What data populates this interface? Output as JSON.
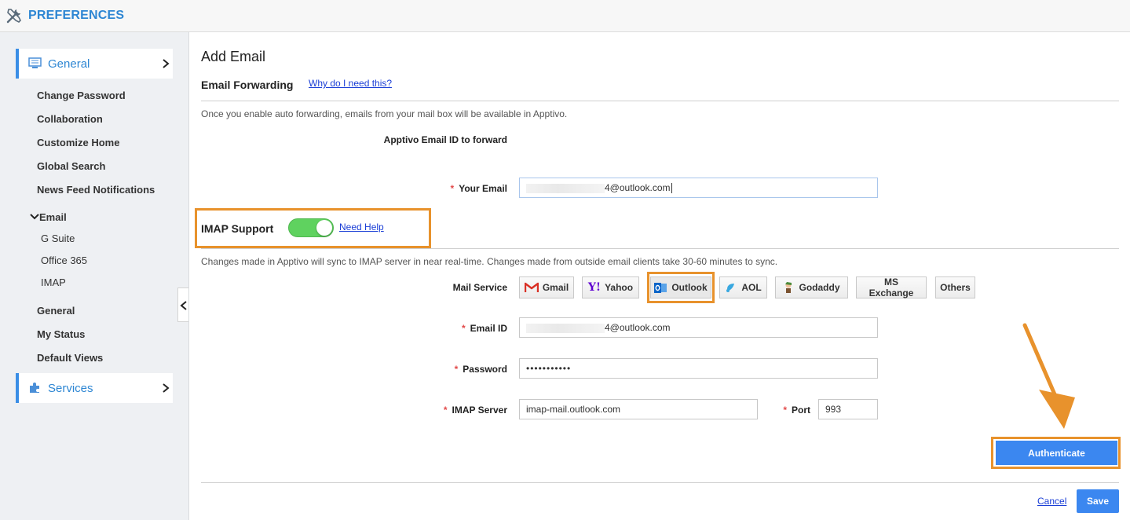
{
  "header": {
    "title": "PREFERENCES",
    "icon": "tools-icon",
    "color": "#2d86d3"
  },
  "sidebar": {
    "general": {
      "label": "General",
      "icon": "monitor-icon"
    },
    "items": [
      "Change Password",
      "Collaboration",
      "Customize Home",
      "Global Search",
      "News Feed Notifications"
    ],
    "email_group": {
      "label": "Email",
      "items": [
        "G Suite",
        "Office 365",
        "IMAP"
      ]
    },
    "items2": [
      "General",
      "My Status",
      "Default Views"
    ],
    "services": {
      "label": "Services",
      "icon": "puzzle-icon"
    }
  },
  "main": {
    "title": "Add Email",
    "forwarding": {
      "title": "Email Forwarding",
      "why_link": "Why do I need this?",
      "note": "Once you enable auto forwarding, emails from your mail box will be available in Apptivo.",
      "forward_id_label": "Apptivo Email ID to forward",
      "your_email_label": "Your Email",
      "your_email_value": "4@outlook.com"
    },
    "imap": {
      "label": "IMAP Support",
      "enabled": true,
      "help_link": "Need Help",
      "note": "Changes made in Apptivo will sync to IMAP server in near real-time. Changes made from outside email clients take 30-60 minutes to sync.",
      "mail_service_label": "Mail Service",
      "services": [
        "Gmail",
        "Yahoo",
        "Outlook",
        "AOL",
        "Godaddy",
        "MS Exchange",
        "Others"
      ],
      "selected_service": "Outlook",
      "email_id_label": "Email ID",
      "email_id_value": "4@outlook.com",
      "password_label": "Password",
      "password_value": "•••••••••••",
      "server_label": "IMAP Server",
      "server_value": "imap-mail.outlook.com",
      "port_label": "Port",
      "port_value": "993",
      "authenticate_label": "Authenticate"
    },
    "actions": {
      "cancel_label": "Cancel",
      "save_label": "Save"
    }
  },
  "colors": {
    "accent": "#3b87f0",
    "highlight": "#e8922c",
    "toggle_on": "#5fd25f"
  }
}
